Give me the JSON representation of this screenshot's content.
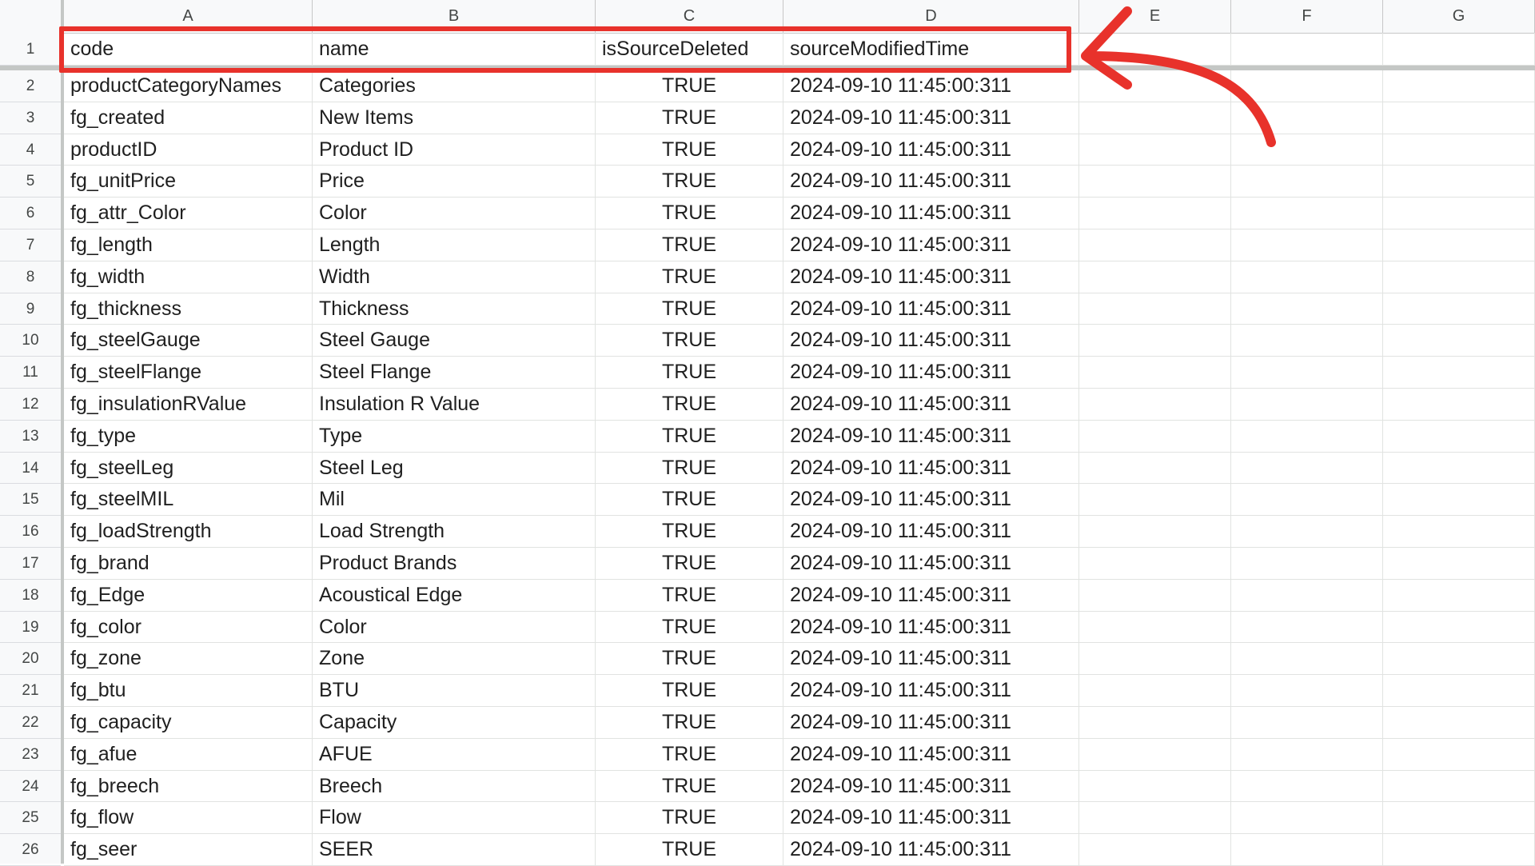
{
  "columns": [
    "A",
    "B",
    "C",
    "D",
    "E",
    "F",
    "G"
  ],
  "header_row": {
    "number": "1",
    "cells": [
      "code",
      "name",
      "isSourceDeleted",
      "sourceModifiedTime"
    ]
  },
  "rows": [
    {
      "n": "2",
      "code": "productCategoryNames",
      "name": "Categories",
      "deleted": "TRUE",
      "time": "2024-09-10 11:45:00:311"
    },
    {
      "n": "3",
      "code": "fg_created",
      "name": "New Items",
      "deleted": "TRUE",
      "time": "2024-09-10 11:45:00:311"
    },
    {
      "n": "4",
      "code": "productID",
      "name": "Product ID",
      "deleted": "TRUE",
      "time": "2024-09-10 11:45:00:311"
    },
    {
      "n": "5",
      "code": "fg_unitPrice",
      "name": "Price",
      "deleted": "TRUE",
      "time": "2024-09-10 11:45:00:311"
    },
    {
      "n": "6",
      "code": "fg_attr_Color",
      "name": "Color",
      "deleted": "TRUE",
      "time": "2024-09-10 11:45:00:311"
    },
    {
      "n": "7",
      "code": "fg_length",
      "name": "Length",
      "deleted": "TRUE",
      "time": "2024-09-10 11:45:00:311"
    },
    {
      "n": "8",
      "code": "fg_width",
      "name": "Width",
      "deleted": "TRUE",
      "time": "2024-09-10 11:45:00:311"
    },
    {
      "n": "9",
      "code": "fg_thickness",
      "name": "Thickness",
      "deleted": "TRUE",
      "time": "2024-09-10 11:45:00:311"
    },
    {
      "n": "10",
      "code": "fg_steelGauge",
      "name": "Steel Gauge",
      "deleted": "TRUE",
      "time": "2024-09-10 11:45:00:311"
    },
    {
      "n": "11",
      "code": "fg_steelFlange",
      "name": "Steel Flange",
      "deleted": "TRUE",
      "time": "2024-09-10 11:45:00:311"
    },
    {
      "n": "12",
      "code": "fg_insulationRValue",
      "name": "Insulation R Value",
      "deleted": "TRUE",
      "time": "2024-09-10 11:45:00:311"
    },
    {
      "n": "13",
      "code": "fg_type",
      "name": "Type",
      "deleted": "TRUE",
      "time": "2024-09-10 11:45:00:311"
    },
    {
      "n": "14",
      "code": "fg_steelLeg",
      "name": "Steel Leg",
      "deleted": "TRUE",
      "time": "2024-09-10 11:45:00:311"
    },
    {
      "n": "15",
      "code": "fg_steelMIL",
      "name": "Mil",
      "deleted": "TRUE",
      "time": "2024-09-10 11:45:00:311"
    },
    {
      "n": "16",
      "code": "fg_loadStrength",
      "name": "Load Strength",
      "deleted": "TRUE",
      "time": "2024-09-10 11:45:00:311"
    },
    {
      "n": "17",
      "code": "fg_brand",
      "name": "Product Brands",
      "deleted": "TRUE",
      "time": "2024-09-10 11:45:00:311"
    },
    {
      "n": "18",
      "code": "fg_Edge",
      "name": "Acoustical Edge",
      "deleted": "TRUE",
      "time": "2024-09-10 11:45:00:311"
    },
    {
      "n": "19",
      "code": "fg_color",
      "name": "Color",
      "deleted": "TRUE",
      "time": "2024-09-10 11:45:00:311"
    },
    {
      "n": "20",
      "code": "fg_zone",
      "name": "Zone",
      "deleted": "TRUE",
      "time": "2024-09-10 11:45:00:311"
    },
    {
      "n": "21",
      "code": "fg_btu",
      "name": "BTU",
      "deleted": "TRUE",
      "time": "2024-09-10 11:45:00:311"
    },
    {
      "n": "22",
      "code": "fg_capacity",
      "name": "Capacity",
      "deleted": "TRUE",
      "time": "2024-09-10 11:45:00:311"
    },
    {
      "n": "23",
      "code": "fg_afue",
      "name": "AFUE",
      "deleted": "TRUE",
      "time": "2024-09-10 11:45:00:311"
    },
    {
      "n": "24",
      "code": "fg_breech",
      "name": "Breech",
      "deleted": "TRUE",
      "time": "2024-09-10 11:45:00:311"
    },
    {
      "n": "25",
      "code": "fg_flow",
      "name": "Flow",
      "deleted": "TRUE",
      "time": "2024-09-10 11:45:00:311"
    },
    {
      "n": "26",
      "code": "fg_seer",
      "name": "SEER",
      "deleted": "TRUE",
      "time": "2024-09-10 11:45:00:311"
    }
  ],
  "colors": {
    "annotation": "#e8322b",
    "header_bg": "#f8f9fa",
    "gridline": "#e1e3e1"
  }
}
